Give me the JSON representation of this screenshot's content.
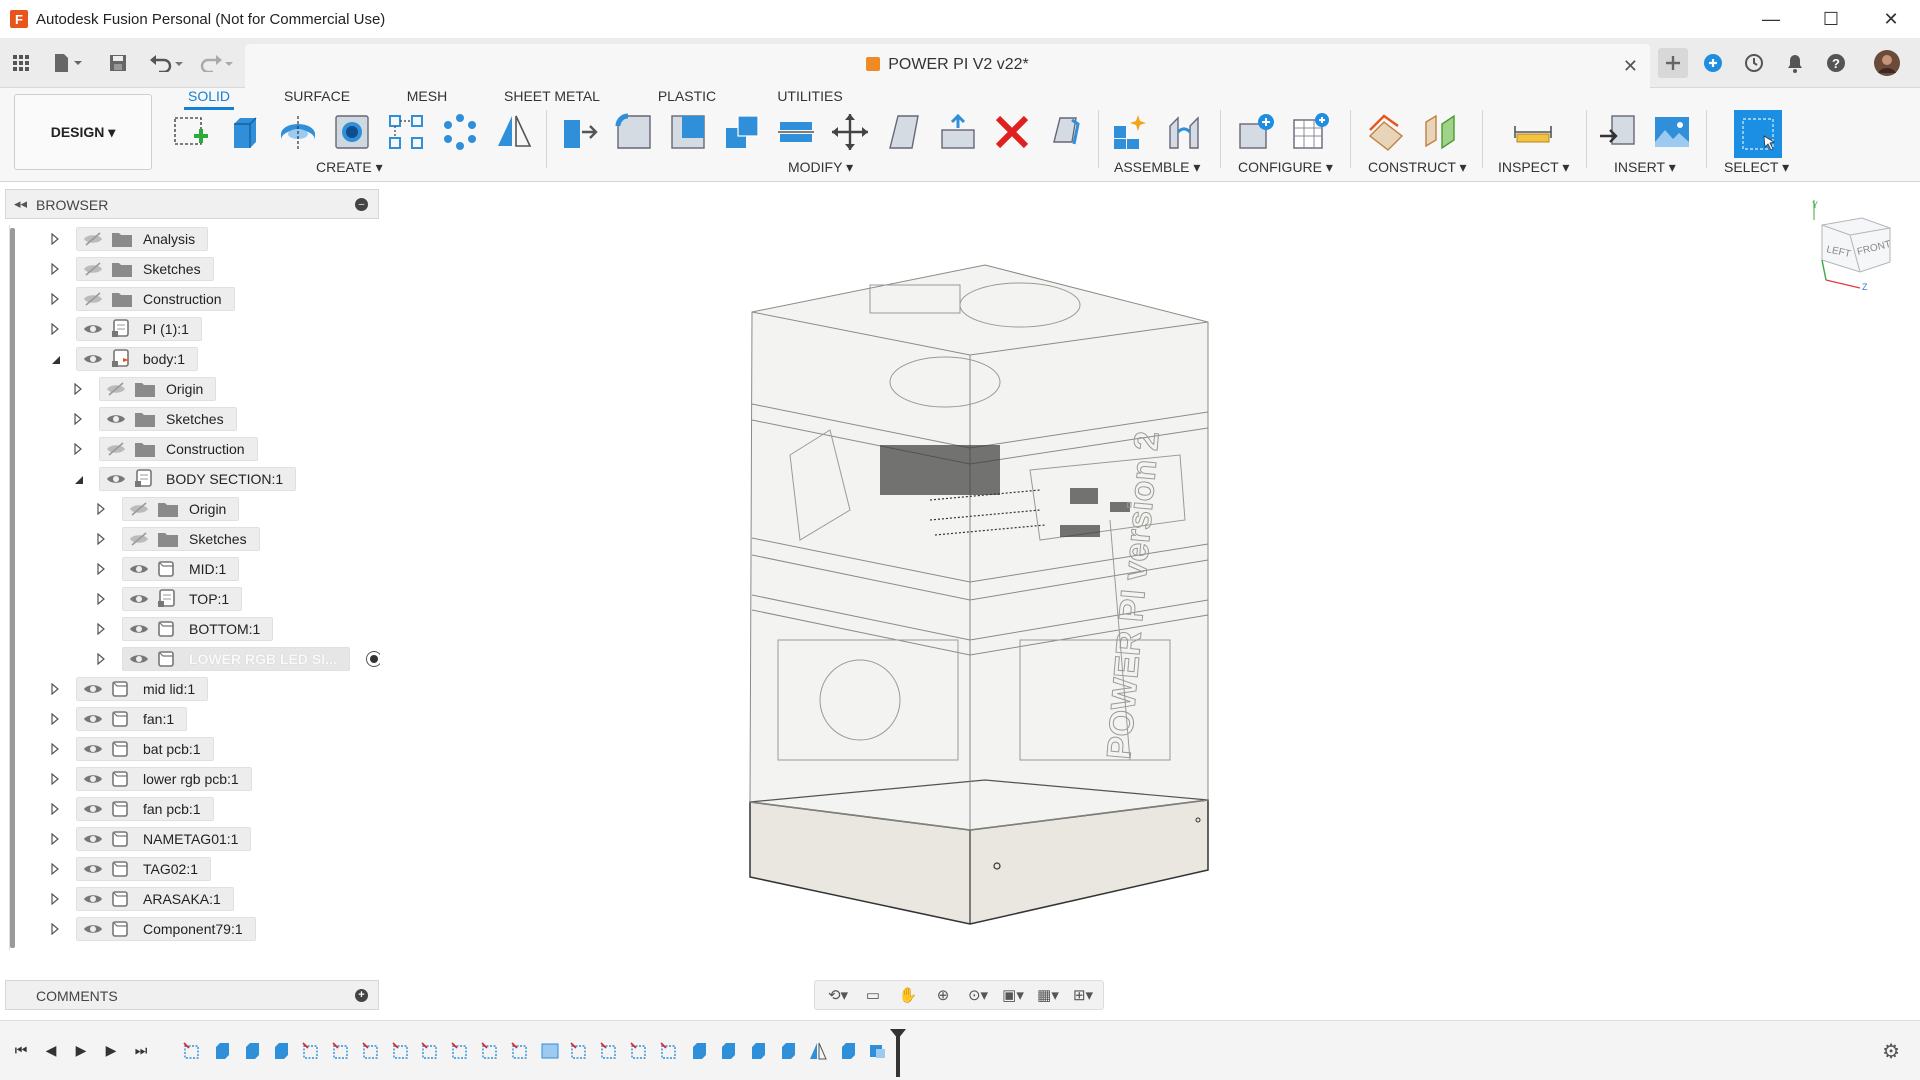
{
  "window": {
    "title": "Autodesk Fusion Personal (Not for Commercial Use)",
    "logo_letter": "F",
    "minimize": "—",
    "maximize": "☐",
    "close": "✕"
  },
  "document": {
    "title": "POWER PI V2 v22*",
    "close": "✕"
  },
  "workspace": {
    "label": "DESIGN ▾"
  },
  "tabs": [
    "SOLID",
    "SURFACE",
    "MESH",
    "SHEET METAL",
    "PLASTIC",
    "UTILITIES"
  ],
  "groups": [
    "CREATE ▾",
    "MODIFY ▾",
    "ASSEMBLE ▾",
    "CONFIGURE ▾",
    "CONSTRUCT ▾",
    "INSPECT ▾",
    "INSERT ▾",
    "SELECT ▾"
  ],
  "browser": {
    "title": "BROWSER",
    "items": [
      {
        "label": "Analysis",
        "level": 0,
        "expanded": false,
        "visible": false,
        "icon": "folder"
      },
      {
        "label": "Sketches",
        "level": 0,
        "expanded": false,
        "visible": false,
        "icon": "folder"
      },
      {
        "label": "Construction",
        "level": 0,
        "expanded": false,
        "visible": false,
        "icon": "folder"
      },
      {
        "label": "PI (1):1",
        "level": 0,
        "expanded": false,
        "visible": true,
        "icon": "component-link"
      },
      {
        "label": "body:1",
        "level": 0,
        "expanded": true,
        "visible": true,
        "icon": "component-active"
      },
      {
        "label": "Origin",
        "level": 1,
        "expanded": false,
        "visible": false,
        "icon": "folder"
      },
      {
        "label": "Sketches",
        "level": 1,
        "expanded": false,
        "visible": true,
        "icon": "folder"
      },
      {
        "label": "Construction",
        "level": 1,
        "expanded": false,
        "visible": false,
        "icon": "folder"
      },
      {
        "label": "BODY SECTION:1",
        "level": 1,
        "expanded": true,
        "visible": true,
        "icon": "component-link"
      },
      {
        "label": "Origin",
        "level": 2,
        "expanded": false,
        "visible": false,
        "icon": "folder"
      },
      {
        "label": "Sketches",
        "level": 2,
        "expanded": false,
        "visible": false,
        "icon": "folder"
      },
      {
        "label": "MID:1",
        "level": 2,
        "expanded": false,
        "visible": true,
        "icon": "component"
      },
      {
        "label": "TOP:1",
        "level": 2,
        "expanded": false,
        "visible": true,
        "icon": "component-link"
      },
      {
        "label": "BOTTOM:1",
        "level": 2,
        "expanded": false,
        "visible": true,
        "icon": "component"
      },
      {
        "label": "LOWER RGB LED SI...",
        "level": 2,
        "expanded": false,
        "visible": true,
        "icon": "component",
        "selected": true
      },
      {
        "label": "mid lid:1",
        "level": 0,
        "expanded": false,
        "visible": true,
        "icon": "component"
      },
      {
        "label": "fan:1",
        "level": 0,
        "expanded": false,
        "visible": true,
        "icon": "component"
      },
      {
        "label": "bat pcb:1",
        "level": 0,
        "expanded": false,
        "visible": true,
        "icon": "component"
      },
      {
        "label": "lower rgb pcb:1",
        "level": 0,
        "expanded": false,
        "visible": true,
        "icon": "component"
      },
      {
        "label": "fan pcb:1",
        "level": 0,
        "expanded": false,
        "visible": true,
        "icon": "component"
      },
      {
        "label": "NAMETAG01:1",
        "level": 0,
        "expanded": false,
        "visible": true,
        "icon": "component"
      },
      {
        "label": "TAG02:1",
        "level": 0,
        "expanded": false,
        "visible": true,
        "icon": "component"
      },
      {
        "label": "ARASAKA:1",
        "level": 0,
        "expanded": false,
        "visible": true,
        "icon": "component"
      },
      {
        "label": "Component79:1",
        "level": 0,
        "expanded": false,
        "visible": true,
        "icon": "component"
      }
    ]
  },
  "comments": {
    "title": "COMMENTS"
  },
  "viewcube": {
    "left": "LEFT",
    "front": "FRONT",
    "y_axis": "Y",
    "z_axis": "Z"
  },
  "model": {
    "side_text": "POWER PI version 2"
  },
  "colors": {
    "accent": "#1480d6",
    "logo": "#e8551a",
    "doc_icon": "#f08a24",
    "delete_red": "#e02020",
    "tool_blue": "#2f8fd8",
    "base_fill": "#e9e7df"
  }
}
